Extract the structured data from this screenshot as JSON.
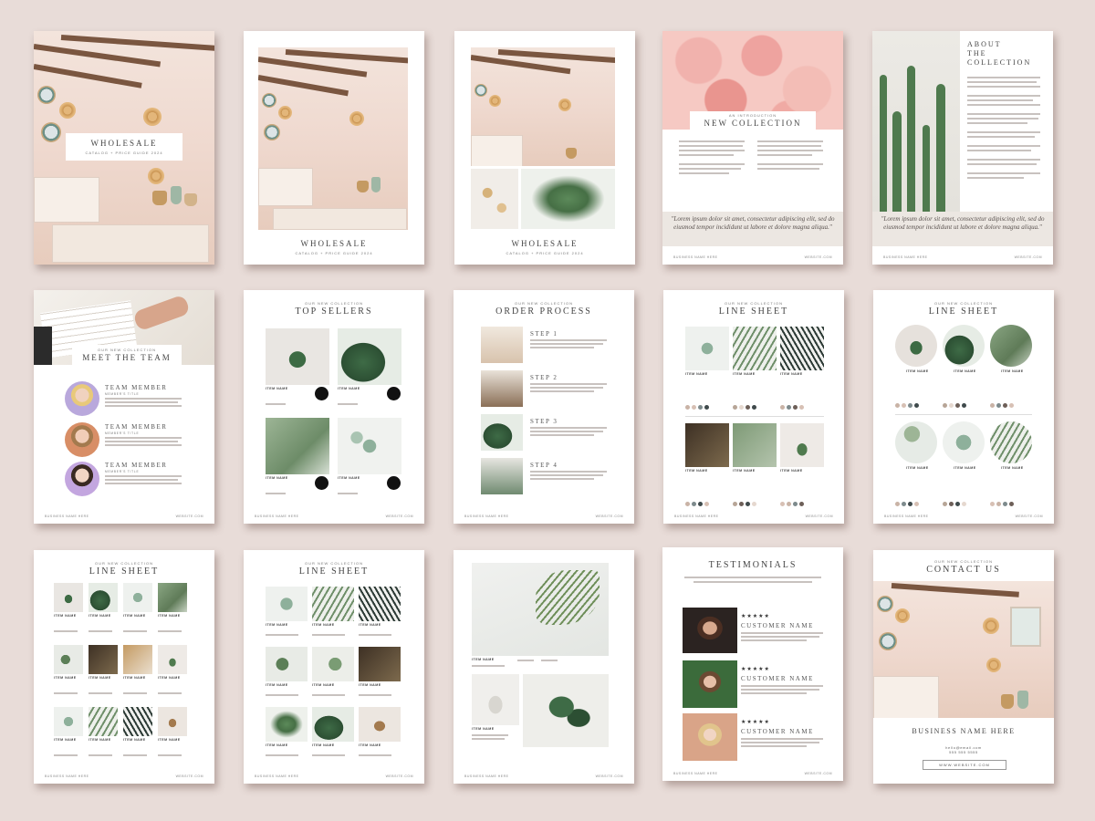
{
  "pages": {
    "p1": {
      "title": "WHOLESALE",
      "subtitle": "CATALOG + PRICE GUIDE 2024"
    },
    "p2": {
      "title": "WHOLESALE",
      "subtitle": "CATALOG + PRICE GUIDE 2024"
    },
    "p3": {
      "title": "WHOLESALE",
      "subtitle": "CATALOG + PRICE GUIDE 2024"
    },
    "p4": {
      "kicker": "AN INTRODUCTION",
      "title": "NEW COLLECTION",
      "quote": "\"Lorem ipsum dolor sit amet, consectetur adipiscing elit, sed do eiusmod tempor incididunt ut labore et dolore magna aliqua.\"",
      "footer_left": "BUSINESS NAME HERE",
      "footer_right": "WEBSITE.COM"
    },
    "p5": {
      "title_lines": [
        "ABOUT",
        "THE",
        "COLLECTION"
      ],
      "quote": "\"Lorem ipsum dolor sit amet, consectetur adipiscing elit, sed do eiusmod tempor incididunt ut labore et dolore magna aliqua.\"",
      "footer_left": "BUSINESS NAME HERE",
      "footer_right": "WEBSITE.COM"
    },
    "p6": {
      "kicker": "OUR NEW COLLECTION",
      "title": "MEET THE TEAM",
      "members": [
        {
          "name": "TEAM MEMBER",
          "role": "MEMBER'S TITLE"
        },
        {
          "name": "TEAM MEMBER",
          "role": "MEMBER'S TITLE"
        },
        {
          "name": "TEAM MEMBER",
          "role": "MEMBER'S TITLE"
        }
      ],
      "footer_left": "BUSINESS NAME HERE",
      "footer_right": "WEBSITE.COM"
    },
    "p7": {
      "kicker": "OUR NEW COLLECTION",
      "title": "TOP SELLERS",
      "item_label": "ITEM NAME",
      "footer_left": "BUSINESS NAME HERE",
      "footer_right": "WEBSITE.COM"
    },
    "p8": {
      "kicker": "OUR NEW COLLECTION",
      "title": "ORDER PROCESS",
      "steps": [
        "STEP 1",
        "STEP 2",
        "STEP 3",
        "STEP 4"
      ],
      "footer_left": "BUSINESS NAME HERE",
      "footer_right": "WEBSITE.COM"
    },
    "p9": {
      "kicker": "OUR NEW COLLECTION",
      "title": "LINE SHEET",
      "item_label": "ITEM NAME",
      "footer_left": "BUSINESS NAME HERE",
      "footer_right": "WEBSITE.COM"
    },
    "p10": {
      "kicker": "OUR NEW COLLECTION",
      "title": "LINE SHEET",
      "item_label": "ITEM NAME",
      "footer_left": "BUSINESS NAME HERE",
      "footer_right": "WEBSITE.COM"
    },
    "p11": {
      "kicker": "OUR NEW COLLECTION",
      "title": "LINE SHEET",
      "item_label": "ITEM NAME",
      "footer_left": "BUSINESS NAME HERE",
      "footer_right": "WEBSITE.COM"
    },
    "p12": {
      "kicker": "OUR NEW COLLECTION",
      "title": "LINE SHEET",
      "item_label": "ITEM NAME",
      "footer_left": "BUSINESS NAME HERE",
      "footer_right": "WEBSITE.COM"
    },
    "p13": {
      "item_label": "ITEM NAME",
      "footer_left": "BUSINESS NAME HERE",
      "footer_right": "WEBSITE.COM"
    },
    "p14": {
      "title": "TESTIMONIALS",
      "stars": "★★★★★",
      "customers": [
        "CUSTOMER NAME",
        "CUSTOMER NAME",
        "CUSTOMER NAME"
      ],
      "footer_left": "BUSINESS NAME HERE",
      "footer_right": "WEBSITE.COM"
    },
    "p15": {
      "kicker": "OUR NEW COLLECTION",
      "title": "CONTACT US",
      "business": "BUSINESS NAME HERE",
      "email": "hello@email.com",
      "phone": "555 555 5555",
      "website": "WWW.WEBSITE.COM"
    }
  },
  "colors": {
    "background": "#e8dcd8",
    "page": "#ffffff",
    "text": "#444444",
    "accent": "#ece7e2"
  },
  "swatch_colors": [
    "#c9b3a6",
    "#d7c0b4",
    "#7d8a8c",
    "#3f4a4c",
    "#b7a597",
    "#e5d8cf",
    "#6d5f58"
  ]
}
